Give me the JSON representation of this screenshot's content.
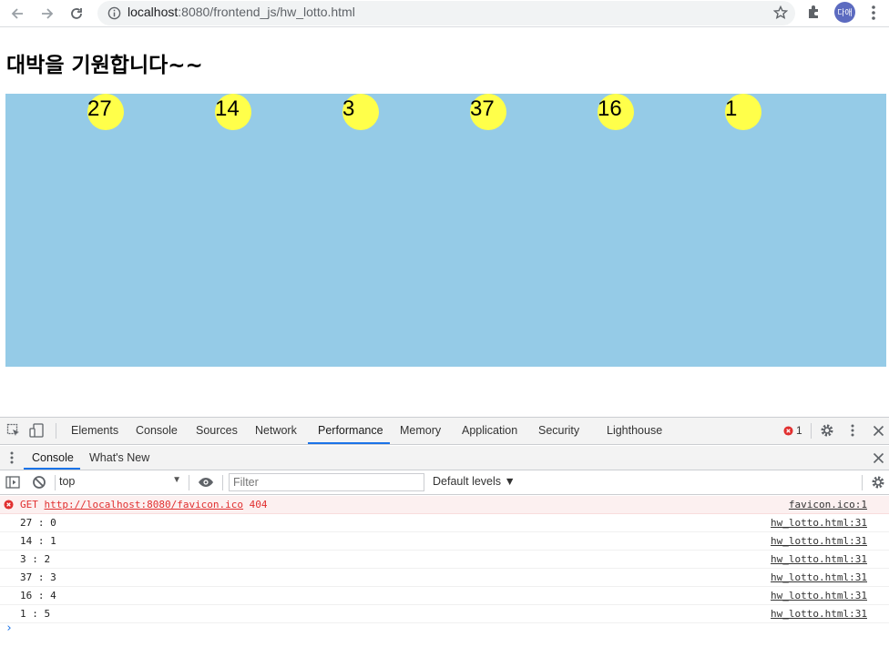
{
  "browser": {
    "url_host": "localhost",
    "url_path": ":8080/frontend_js/hw_lotto.html",
    "profile_initials": "다애"
  },
  "page": {
    "title": "대박을 기원합니다~~",
    "ball_color": "#ffff4a",
    "area_color": "#95cbe7",
    "balls": [
      "27",
      "14",
      "3",
      "37",
      "16",
      "1"
    ]
  },
  "devtools": {
    "tabs": [
      "Elements",
      "Console",
      "Sources",
      "Network",
      "Performance",
      "Memory",
      "Application",
      "Security",
      "Lighthouse"
    ],
    "active_tab": "Performance",
    "error_count": "1",
    "drawer_tabs": [
      "Console",
      "What's New"
    ],
    "context": "top",
    "filter_placeholder": "Filter",
    "levels": "Default levels ▼",
    "error_row": {
      "method": "GET",
      "url": "http://localhost:8080/favicon.ico",
      "code": "404",
      "source": "favicon.ico:1"
    },
    "log_rows": [
      {
        "msg": "27 : 0",
        "source": "hw_lotto.html:31"
      },
      {
        "msg": "14 : 1",
        "source": "hw_lotto.html:31"
      },
      {
        "msg": "3 : 2",
        "source": "hw_lotto.html:31"
      },
      {
        "msg": "37 : 3",
        "source": "hw_lotto.html:31"
      },
      {
        "msg": "16 : 4",
        "source": "hw_lotto.html:31"
      },
      {
        "msg": "1 : 5",
        "source": "hw_lotto.html:31"
      }
    ]
  }
}
